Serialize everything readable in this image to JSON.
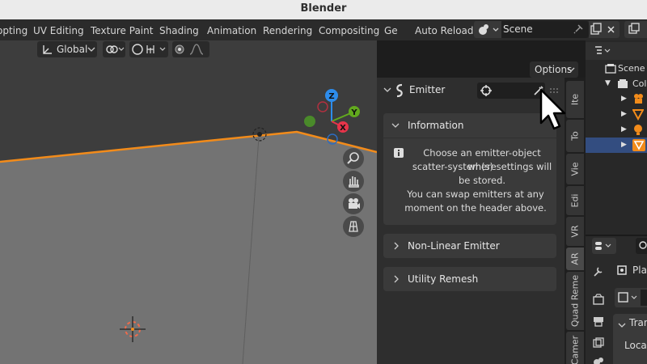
{
  "app": {
    "title": "Blender"
  },
  "workspace_tabs": [
    "opting",
    "UV Editing",
    "Texture Paint",
    "Shading",
    "Animation",
    "Rendering",
    "Compositing",
    "Ge"
  ],
  "header_right": {
    "auto_reload": "Auto Reload",
    "scene": "Scene"
  },
  "viewport": {
    "orientation": "Global",
    "options": "Options",
    "gizmo": {
      "z": "Z",
      "y": "Y",
      "x": "X"
    }
  },
  "npanel": {
    "emitter_label": "Emitter",
    "information_title": "Information",
    "info_lines": [
      "Choose an emitter-object where",
      "scatter-system(s) settings will",
      "be stored.",
      "You can swap emitters at any",
      "moment on the header above."
    ],
    "non_linear": "Non-Linear Emitter",
    "utility_remesh": "Utility Remesh"
  },
  "vertical_tabs": [
    "Ite",
    "To",
    "Vie",
    "Edi",
    "VR",
    "AR",
    "Quad Reme",
    "Camer"
  ],
  "outliner": {
    "scene": "Scene c",
    "collection": "Col"
  },
  "properties": {
    "object_name": "Plar",
    "transform": "Tran",
    "location": "Locat"
  },
  "colors": {
    "accent_blue": "#4772b3",
    "selection_orange": "#f28b1a",
    "axis_x": "#e6344a",
    "axis_y": "#62a91e",
    "axis_z": "#2d8ceb"
  }
}
